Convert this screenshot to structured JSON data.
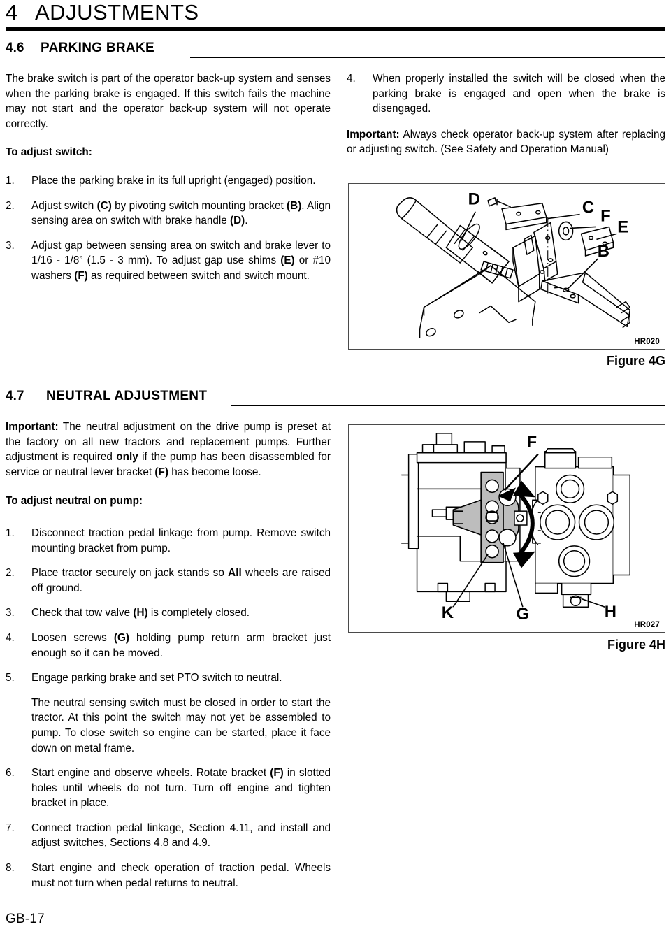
{
  "header": {
    "chapter_number": "4",
    "chapter_title": "ADJUSTMENTS"
  },
  "sections": [
    {
      "number": "4.6",
      "title": "PARKING BRAKE"
    },
    {
      "number": "4.7",
      "title": "NEUTRAL ADJUSTMENT"
    }
  ],
  "section46": {
    "intro": "The brake switch is part of the operator back-up system and senses when the parking brake is engaged. If this switch fails the machine may not start and the operator back-up system will not operate correctly.",
    "subhead": "To adjust switch:",
    "items": [
      {
        "num": "1.",
        "parts": [
          {
            "t": "Place the parking brake in its full upright (engaged) position.",
            "b": false
          }
        ]
      },
      {
        "num": "2.",
        "parts": [
          {
            "t": "Adjust switch ",
            "b": false
          },
          {
            "t": "(C)",
            "b": true
          },
          {
            "t": " by pivoting switch mounting bracket ",
            "b": false
          },
          {
            "t": "(B)",
            "b": true
          },
          {
            "t": ". Align sensing area on switch with brake handle ",
            "b": false
          },
          {
            "t": "(D)",
            "b": true
          },
          {
            "t": ".",
            "b": false
          }
        ]
      },
      {
        "num": "3.",
        "parts": [
          {
            "t": "Adjust gap between sensing area on switch and brake lever to 1/16 - 1/8” (1.5 - 3 mm). To adjust gap use shims ",
            "b": false
          },
          {
            "t": "(E)",
            "b": true
          },
          {
            "t": " or #10 washers ",
            "b": false
          },
          {
            "t": "(F)",
            "b": true
          },
          {
            "t": " as required between switch and switch mount.",
            "b": false
          }
        ]
      },
      {
        "num": "4.",
        "parts": [
          {
            "t": "When properly installed the switch will be closed when the parking brake is engaged and open when the brake is disengaged.",
            "b": false
          }
        ]
      }
    ],
    "important": [
      {
        "t": "Important:",
        "b": true
      },
      {
        "t": " Always check operator back-up system after replacing or adjusting switch. (See Safety and Operation Manual)",
        "b": false
      }
    ]
  },
  "section47": {
    "important": [
      {
        "t": "Important:",
        "b": true
      },
      {
        "t": " The neutral adjustment on the drive pump is preset at the factory on all new tractors and replacement pumps. Further adjustment is required ",
        "b": false
      },
      {
        "t": "only",
        "b": true
      },
      {
        "t": " if the pump has been disassembled for service or neutral lever bracket ",
        "b": false
      },
      {
        "t": "(F)",
        "b": true
      },
      {
        "t": " has become loose.",
        "b": false
      }
    ],
    "subhead": "To adjust neutral on pump:",
    "items": [
      {
        "num": "1.",
        "parts": [
          {
            "t": "Disconnect traction pedal linkage from pump. Remove switch mounting bracket from pump.",
            "b": false
          }
        ]
      },
      {
        "num": "2.",
        "parts": [
          {
            "t": "Place tractor securely on jack stands so ",
            "b": false
          },
          {
            "t": "All",
            "b": true
          },
          {
            "t": " wheels are raised off ground.",
            "b": false
          }
        ]
      },
      {
        "num": "3.",
        "parts": [
          {
            "t": "Check that tow valve ",
            "b": false
          },
          {
            "t": "(H)",
            "b": true
          },
          {
            "t": " is completely closed.",
            "b": false
          }
        ]
      },
      {
        "num": "4.",
        "parts": [
          {
            "t": "Loosen screws ",
            "b": false
          },
          {
            "t": "(G)",
            "b": true
          },
          {
            "t": " holding pump return arm bracket just enough so it can be moved.",
            "b": false
          }
        ]
      },
      {
        "num": "5.",
        "parts": [
          {
            "t": "Engage parking brake and set PTO switch to neutral.",
            "b": false
          }
        ]
      },
      {
        "num": "6.",
        "parts": [
          {
            "t": "Start engine and observe wheels. Rotate bracket ",
            "b": false
          },
          {
            "t": "(F)",
            "b": true
          },
          {
            "t": " in slotted holes until wheels do not turn. Turn off engine and tighten bracket in place.",
            "b": false
          }
        ]
      },
      {
        "num": "7.",
        "parts": [
          {
            "t": "Connect traction pedal linkage, Section 4.11, and install and adjust switches, Sections 4.8 and 4.9.",
            "b": false
          }
        ]
      },
      {
        "num": "8.",
        "parts": [
          {
            "t": "Start engine and check operation of traction pedal. Wheels must not turn when pedal returns to neutral.",
            "b": false
          }
        ]
      }
    ],
    "note_after_5": "The neutral sensing switch must be closed in order to start the tractor. At this point the switch may not yet be assembled to pump. To close switch so engine can be started, place it face down on metal frame."
  },
  "figures": [
    {
      "id": "4g",
      "code": "HR020",
      "caption": "Figure 4G",
      "labels": [
        "D",
        "C",
        "F",
        "E",
        "B"
      ]
    },
    {
      "id": "4h",
      "code": "HR027",
      "caption": "Figure 4H",
      "labels": [
        "F",
        "K",
        "G",
        "H"
      ]
    }
  ],
  "footer": {
    "page_label": "GB-17"
  },
  "colors": {
    "text": "#000000",
    "rule": "#000000",
    "figure_border": "#4a4a4a",
    "figure_shade": "#bdbdbd"
  }
}
